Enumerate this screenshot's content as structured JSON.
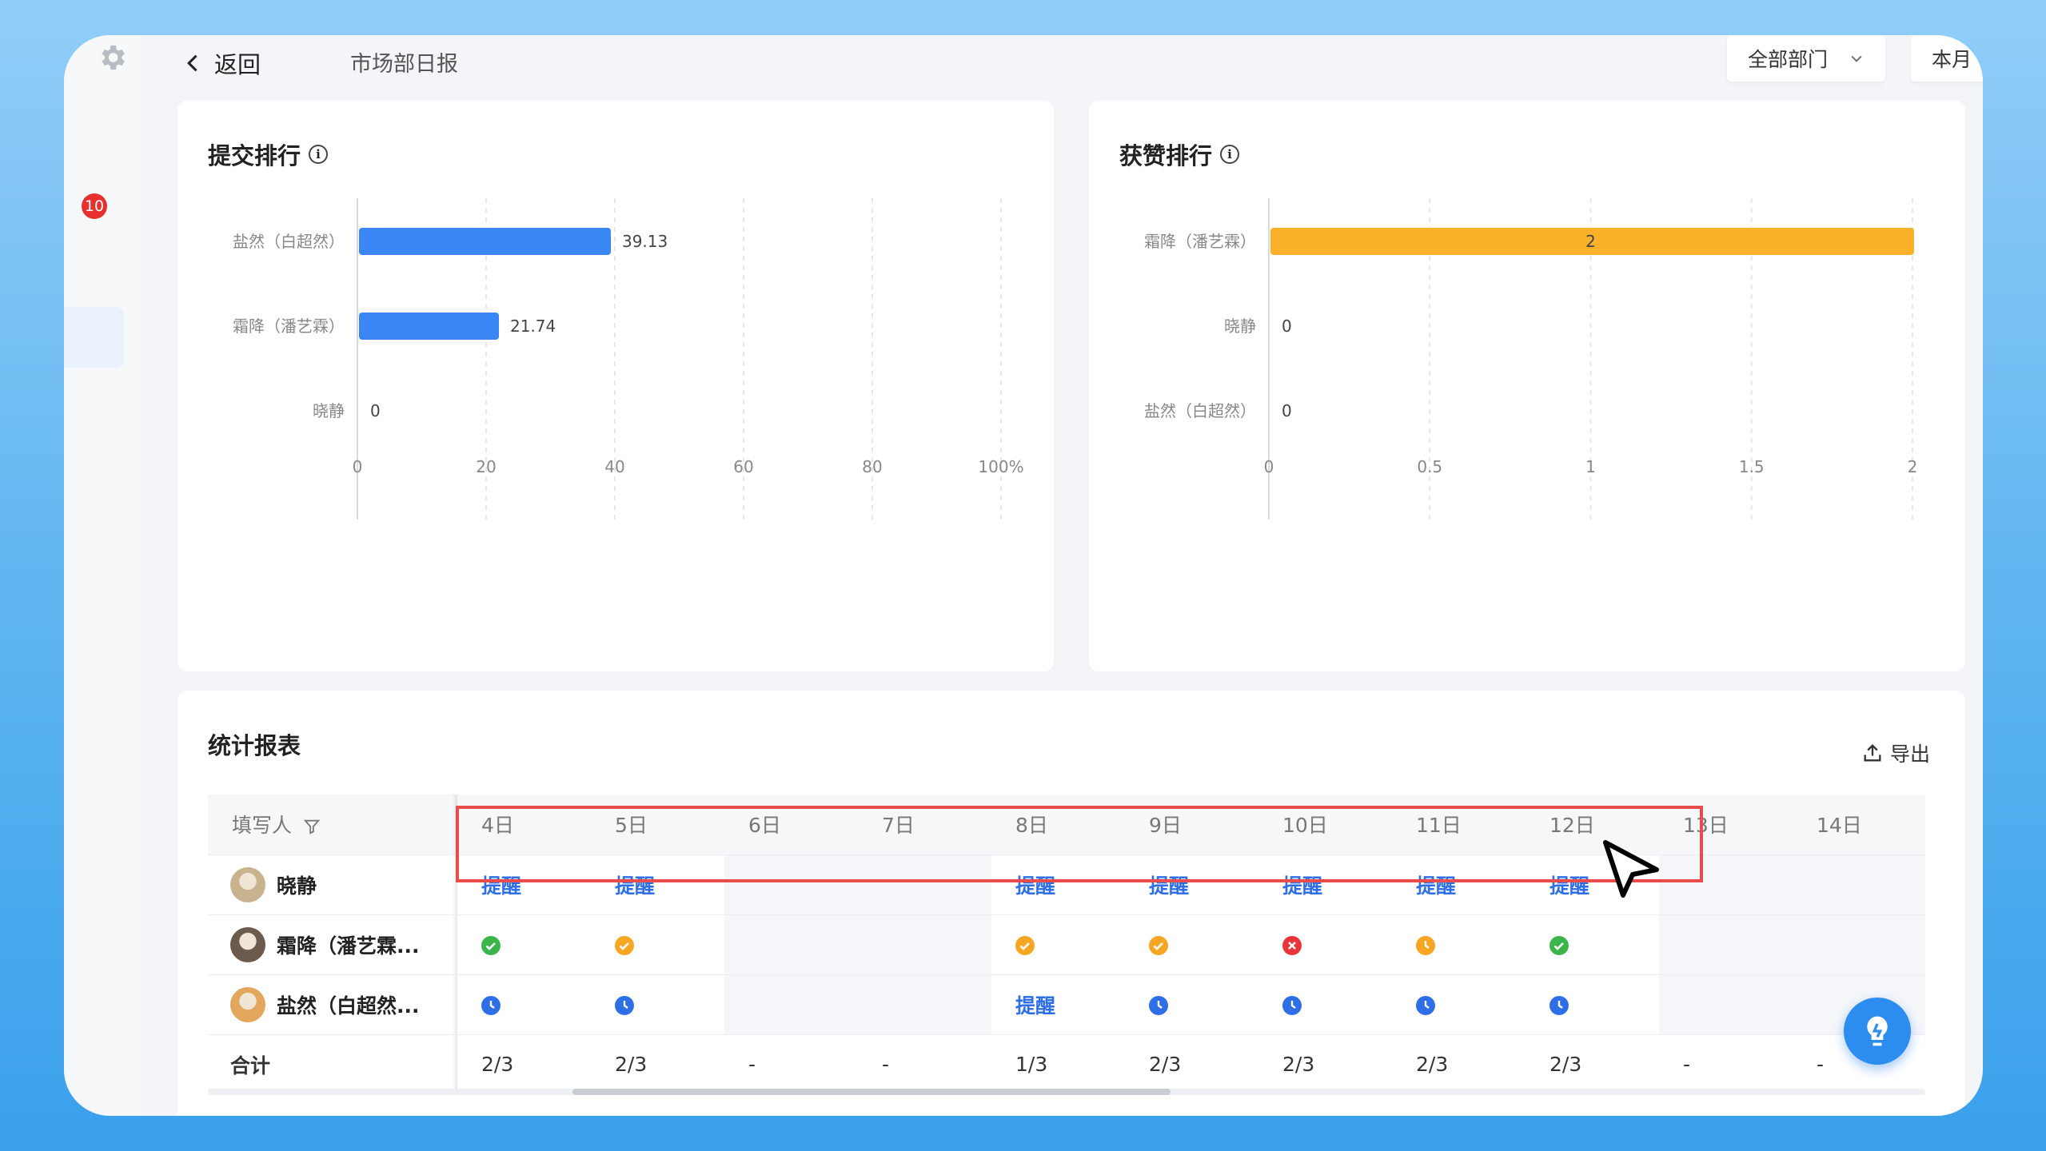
{
  "topbar": {
    "back_label": "返回",
    "page_title": "市场部日报",
    "department_filter": "全部部门",
    "period_filter": "本月"
  },
  "sidebar": {
    "notification_count": "10"
  },
  "submission_ranking": {
    "title": "提交排行",
    "chart_data": {
      "type": "bar",
      "orientation": "horizontal",
      "categories": [
        "盐然（白超然）",
        "霜降（潘艺霖）",
        "晓静"
      ],
      "values": [
        39.13,
        21.74,
        0
      ],
      "value_labels": [
        "39.13",
        "21.74",
        "0"
      ],
      "xlim": [
        0,
        100
      ],
      "x_ticks": [
        "0",
        "20",
        "40",
        "60",
        "80",
        "100%"
      ],
      "bar_color": "#3a86f5",
      "grid": true
    }
  },
  "likes_ranking": {
    "title": "获赞排行",
    "chart_data": {
      "type": "bar",
      "orientation": "horizontal",
      "categories": [
        "霜降（潘艺霖）",
        "晓静",
        "盐然（白超然）"
      ],
      "values": [
        2,
        0,
        0
      ],
      "value_labels": [
        "2",
        "0",
        "0"
      ],
      "xlim": [
        0,
        2
      ],
      "x_ticks": [
        "0",
        "0.5",
        "1",
        "1.5",
        "2"
      ],
      "bar_color": "#fbb22a",
      "grid": true
    }
  },
  "stats": {
    "title": "统计报表",
    "export_label": "导出",
    "filler_header": "填写人",
    "dates": [
      "4日",
      "5日",
      "6日",
      "7日",
      "8日",
      "9日",
      "10日",
      "11日",
      "12日",
      "13日",
      "14日"
    ],
    "rows": [
      {
        "name": "晓静",
        "cells": [
          "remind",
          "remind",
          "gray",
          "gray",
          "remind",
          "remind",
          "remind",
          "remind",
          "remind",
          "gray",
          "gray"
        ]
      },
      {
        "name": "霜降（潘艺霖...",
        "cells": [
          "ok",
          "ok-orange",
          "gray",
          "gray",
          "ok-orange",
          "ok-orange",
          "fail",
          "late",
          "ok",
          "gray",
          "gray"
        ]
      },
      {
        "name": "盐然（白超然...",
        "cells": [
          "pending",
          "pending",
          "gray",
          "gray",
          "remind",
          "pending",
          "pending",
          "pending",
          "pending",
          "gray",
          "gray"
        ]
      }
    ],
    "remind_label": "提醒",
    "total_label": "合计",
    "totals": [
      "2/3",
      "2/3",
      "-",
      "-",
      "1/3",
      "2/3",
      "2/3",
      "2/3",
      "2/3",
      "-",
      "-"
    ]
  },
  "colors": {
    "accent": "#2d8cf0",
    "ok": "#3bb54a",
    "warn": "#f5a623",
    "fail": "#e8343a",
    "pending": "#2f6fe6",
    "highlight": "#ea4b4b"
  }
}
